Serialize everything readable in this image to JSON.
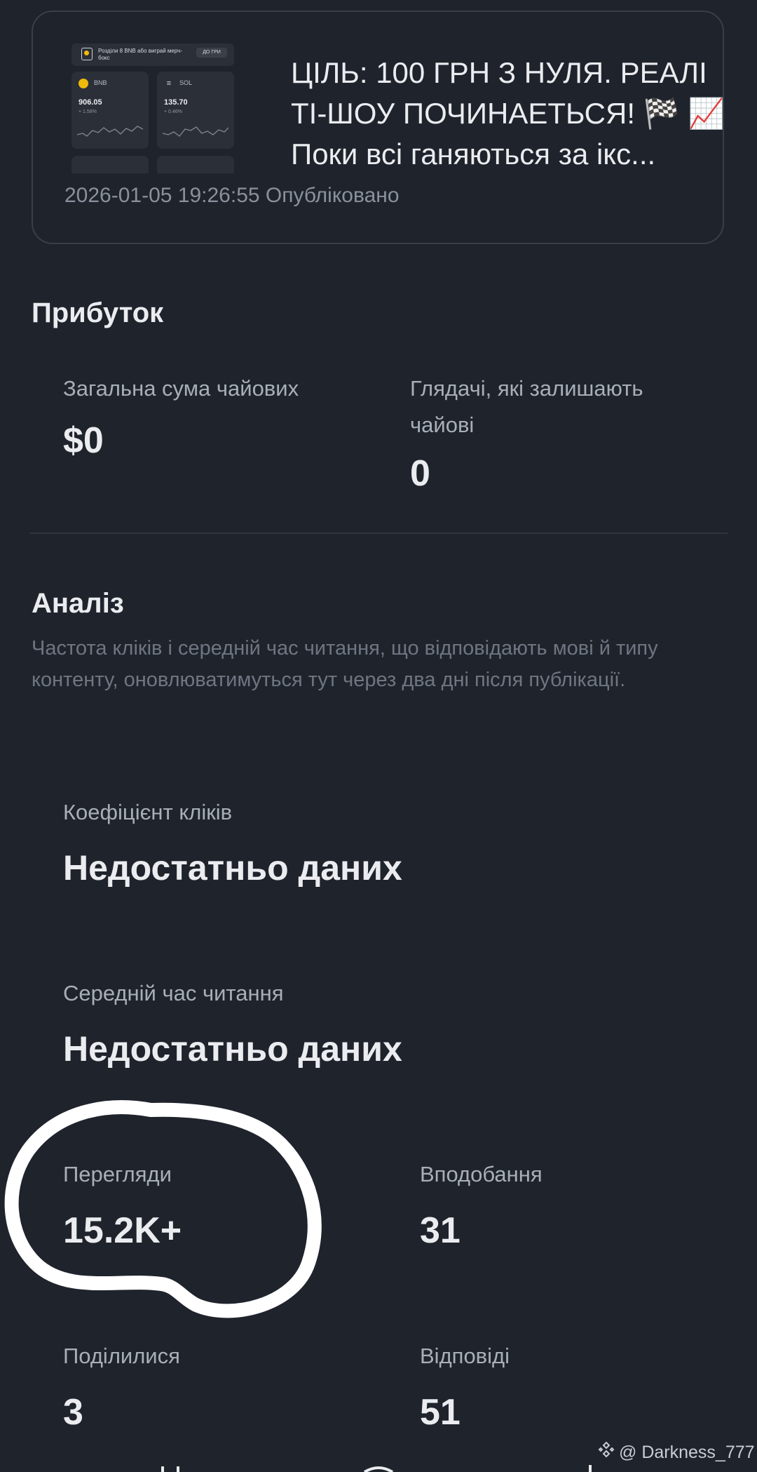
{
  "post": {
    "thumbnail": {
      "banner_text": "Розділи 8 BNB або виграй мерч-бокс",
      "banner_button": "ДО ГРИ",
      "cards": [
        {
          "coin": "BNB",
          "price": "906.05",
          "change": "+ 1.58%"
        },
        {
          "coin": "SOL",
          "price": "135.70",
          "change": "+ 0.46%"
        }
      ]
    },
    "title": "ЦІЛЬ: 100 ГРН З НУЛЯ. РЕАЛІ ТІ-ШОУ ПОЧИНАЕТЬСЯ! 🏁 📈Поки всі ганяються за ікс...",
    "meta": "2026-01-05 19:26:55 Опубліковано"
  },
  "earnings": {
    "title": "Прибуток",
    "total_tips_label": "Загальна сума чайових",
    "total_tips_value": "$0",
    "tippers_label": "Глядачі, які залишають чайові",
    "tippers_value": "0"
  },
  "analysis": {
    "title": "Аналіз",
    "description": "Частота кліків і середній час читання, що відповідають мові й типу контенту, оновлюватимуться тут через два дні після публікації.",
    "ctr_label": "Коефіцієнт кліків",
    "ctr_value": "Недостатньо даних",
    "avg_read_label": "Середній час читання",
    "avg_read_value": "Недостатньо даних",
    "views_label": "Перегляди",
    "views_value": "15.2K+",
    "likes_label": "Вподобання",
    "likes_value": "31",
    "shares_label": "Поділилися",
    "shares_value": "3",
    "replies_label": "Відповіді",
    "replies_value": "51"
  },
  "watermark": {
    "text": "@ Darkness_777"
  },
  "colors": {
    "background": "#1f232c",
    "card_border": "#393e48",
    "text_primary": "#eaecef",
    "text_secondary": "#a8afb9",
    "annotation": "#ffffff"
  }
}
